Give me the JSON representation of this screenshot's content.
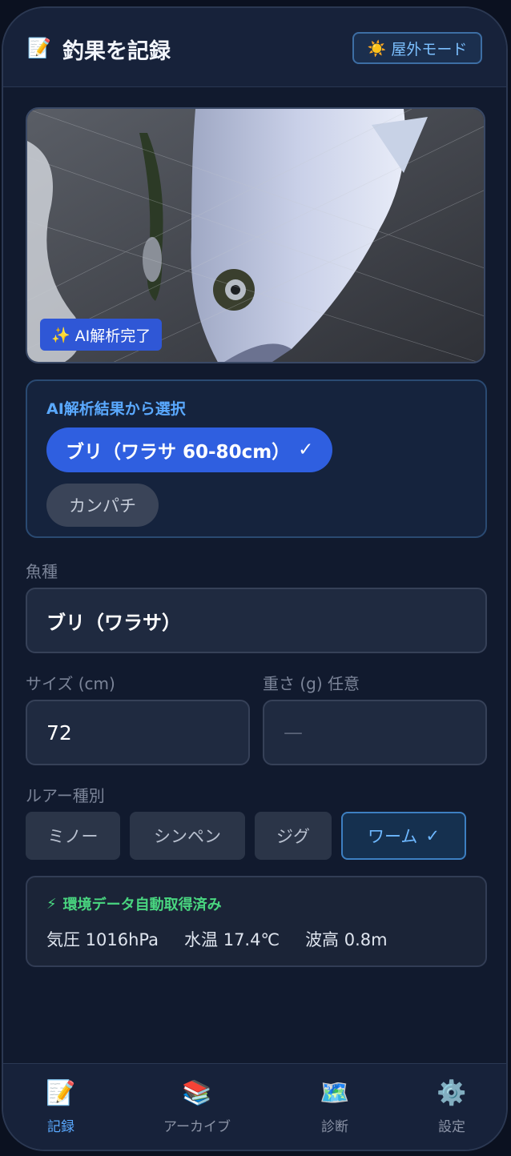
{
  "header": {
    "title_icon": "memo-icon",
    "title_emoji": "📝",
    "title": "釣果を記録",
    "outdoor_button": {
      "icon": "sun-icon",
      "emoji": "☀️",
      "label": "屋外モード"
    }
  },
  "photo": {
    "badge": {
      "icon": "sparkles-icon",
      "emoji": "✨",
      "label": "AI解析完了"
    }
  },
  "ai_results": {
    "title": "AI解析結果から選択",
    "selected": {
      "label": "ブリ（ワラサ 60-80cm）",
      "check": "✓"
    },
    "other": {
      "label": "カンパチ"
    }
  },
  "form": {
    "species": {
      "label": "魚種",
      "value": "ブリ（ワラサ）"
    },
    "size": {
      "label": "サイズ (cm)",
      "value": "72"
    },
    "weight": {
      "label": "重さ (g) 任意",
      "placeholder": "—"
    },
    "lure": {
      "label": "ルアー種別",
      "options": [
        "ミノー",
        "シンペン",
        "ジグ",
        "ワーム"
      ],
      "selected": "ワーム",
      "check": "✓"
    }
  },
  "environment": {
    "icon": "lightning-icon",
    "emoji": "⚡",
    "title": "環境データ自動取得済み",
    "pressure": "気圧 1016hPa",
    "water_temp": "水温 17.4℃",
    "wave": "波高 0.8m"
  },
  "tabs": [
    {
      "label": "記録",
      "emoji": "📝",
      "icon": "memo-icon",
      "active": true
    },
    {
      "label": "アーカイブ",
      "emoji": "📚",
      "icon": "books-icon",
      "active": false
    },
    {
      "label": "診断",
      "emoji": "🗺️",
      "icon": "map-icon",
      "active": false
    },
    {
      "label": "設定",
      "emoji": "⚙️",
      "icon": "gear-icon",
      "active": false
    }
  ],
  "colors": {
    "accent": "#2f5fe0",
    "success": "#49d680",
    "background": "#111a2e"
  }
}
